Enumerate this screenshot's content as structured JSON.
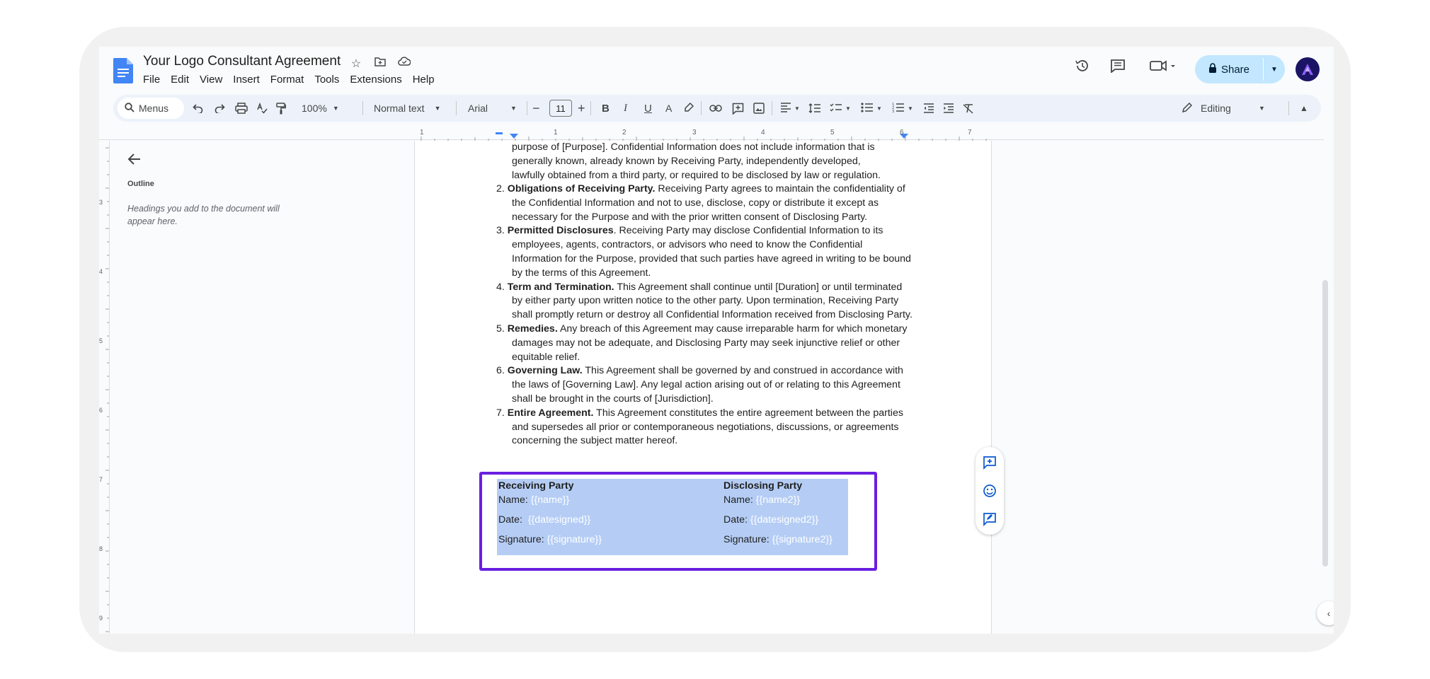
{
  "document": {
    "title": "Your Logo Consultant Agreement",
    "menus": [
      "File",
      "Edit",
      "View",
      "Insert",
      "Format",
      "Tools",
      "Extensions",
      "Help"
    ]
  },
  "header": {
    "share_label": "Share",
    "avatar_icon": "brand-a-icon"
  },
  "toolbar": {
    "search_label": "Menus",
    "zoom": "100%",
    "style": "Normal text",
    "font": "Arial",
    "font_size": "11",
    "mode": "Editing"
  },
  "ruler": {
    "top_numbers": [
      "1",
      "1",
      "2",
      "3",
      "4",
      "5",
      "6",
      "7"
    ],
    "side_numbers": [
      "3",
      "4",
      "5",
      "6",
      "7",
      "8",
      "9"
    ]
  },
  "outline": {
    "title": "Outline",
    "empty_text": "Headings you add to the document will appear here."
  },
  "content": {
    "intro_lines": [
      "purpose of [Purpose]. Confidential Information does not include information that is",
      "generally known, already known by Receiving Party, independently developed,",
      "lawfully obtained from a third party, or required to be disclosed by law or regulation."
    ],
    "items": [
      {
        "num": "2.",
        "heading": "Obligations of Receiving Party.",
        "text": "Receiving Party agrees to maintain the confidentiality of the Confidential Information and not to use, disclose, copy or distribute it except as necessary for the Purpose and with the prior written consent of Disclosing Party."
      },
      {
        "num": "3.",
        "heading": "Permitted Disclosures",
        "text": ". Receiving Party may disclose Confidential Information to its employees, agents, contractors, or advisors who need to know the Confidential Information for the Purpose, provided that such parties have agreed in writing to be bound by the terms of this Agreement."
      },
      {
        "num": "4.",
        "heading": "Term and Termination.",
        "text": "This Agreement shall continue until [Duration] or until terminated by either party upon written notice to the other party. Upon termination, Receiving Party shall promptly return or destroy all Confidential Information received from Disclosing Party."
      },
      {
        "num": "5.",
        "heading": "Remedies.",
        "text": "Any breach of this Agreement may cause irreparable harm for which monetary damages may not be adequate, and Disclosing Party may seek injunctive relief or other equitable relief."
      },
      {
        "num": "6.",
        "heading": "Governing Law.",
        "text": "This Agreement shall be governed by and construed in accordance with the laws of [Governing Law]. Any legal action arising out of or relating to this Agreement shall be brought in the courts of [Jurisdiction]."
      },
      {
        "num": "7.",
        "heading": "Entire Agreement.",
        "text": "This Agreement constitutes the entire agreement between the parties and supersedes all prior or contemporaneous negotiations, discussions, or agreements concerning the subject matter hereof."
      }
    ]
  },
  "signature_table": {
    "left": {
      "heading": "Receiving Party",
      "name_label": "Name:",
      "name_value": "{{name}}",
      "date_label": "Date:",
      "date_value": "{{datesigned}}",
      "sig_label": "Signature:",
      "sig_value": "{{signature}}"
    },
    "right": {
      "heading": "Disclosing Party",
      "name_label": "Name:",
      "name_value": "{{name2}}",
      "date_label": "Date:",
      "date_value": "{{datesigned2}}",
      "sig_label": "Signature:",
      "sig_value": "{{signature2}}"
    }
  },
  "colors": {
    "accent": "#c2e7ff",
    "highlight_border": "#6a1fe0",
    "selection": "#b5cdf5"
  }
}
